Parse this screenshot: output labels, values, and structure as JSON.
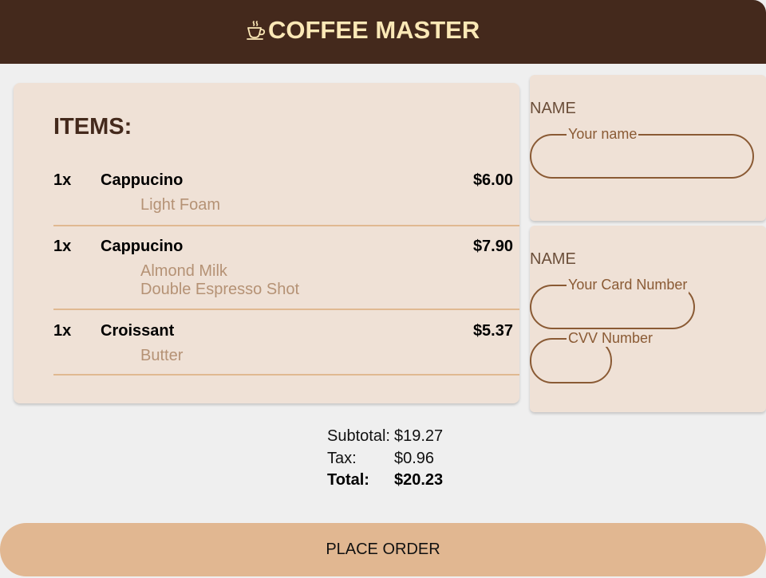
{
  "header": {
    "title": "COFFEE MASTER",
    "logo_icon": "coffee-cup-icon",
    "bg_color": "#44291c",
    "title_color": "#fbe8b6"
  },
  "order": {
    "heading": "ITEMS:",
    "items": [
      {
        "qty": "1x",
        "name": "Cappucino",
        "price": "$6.00",
        "modifiers": [
          "Light Foam"
        ]
      },
      {
        "qty": "1x",
        "name": "Cappucino",
        "price": "$7.90",
        "modifiers": [
          "Almond Milk",
          "Double Espresso Shot"
        ]
      },
      {
        "qty": "1x",
        "name": "Croissant",
        "price": "$5.37",
        "modifiers": [
          "Butter"
        ]
      }
    ]
  },
  "name_form": {
    "label": "NAME",
    "name_placeholder": "Your name",
    "name_value": ""
  },
  "payment_form": {
    "label": "NAME",
    "card_placeholder": "Your Card Number",
    "card_value": "",
    "cvv_placeholder": "CVV Number",
    "cvv_value": ""
  },
  "totals": {
    "subtotal_label": "Subtotal:",
    "subtotal_value": "$19.27",
    "tax_label": "Tax:",
    "tax_value": "$0.96",
    "total_label": "Total:",
    "total_value": "$20.23"
  },
  "place_order_label": "PLACE ORDER",
  "colors": {
    "accent": "#e1b791",
    "card_bg": "#efe1d6",
    "divider": "#e0b991",
    "field_border": "#8a5a34"
  }
}
